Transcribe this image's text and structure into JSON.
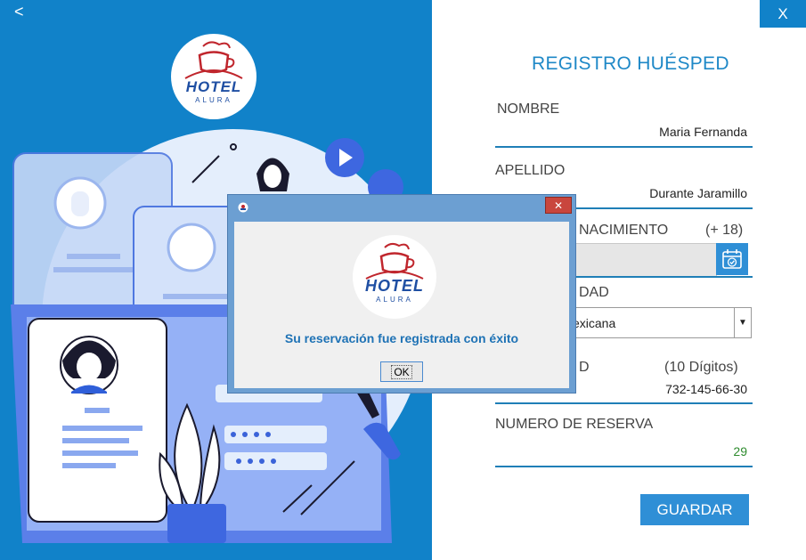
{
  "nav": {
    "back_label": "<",
    "close_label": "X"
  },
  "logo": {
    "line1": "HOTEL",
    "line2": "ALURA"
  },
  "form": {
    "title": "REGISTRO HUÉSPED",
    "nombre": {
      "label": "NOMBRE",
      "value": "Maria Fernanda"
    },
    "apellido": {
      "label": "APELLIDO",
      "value": "Durante Jaramillo"
    },
    "nacimiento": {
      "label": "NACIMIENTO",
      "hint": "(+ 18)",
      "value": ""
    },
    "nacionalidad": {
      "label": "DAD",
      "value": "exicana"
    },
    "telefono": {
      "label": "D",
      "hint": "(10 Dígitos)",
      "value": "732-145-66-30"
    },
    "reserva": {
      "label": "NUMERO DE RESERVA",
      "value": "29"
    },
    "save_label": "GUARDAR"
  },
  "dialog": {
    "close_label": "✕",
    "message": "Su reservación fue registrada con éxito",
    "ok_label": "OK"
  },
  "colors": {
    "accent": "#1182c9",
    "button": "#2f8fd6",
    "reserva_value": "#2e8b2e"
  }
}
